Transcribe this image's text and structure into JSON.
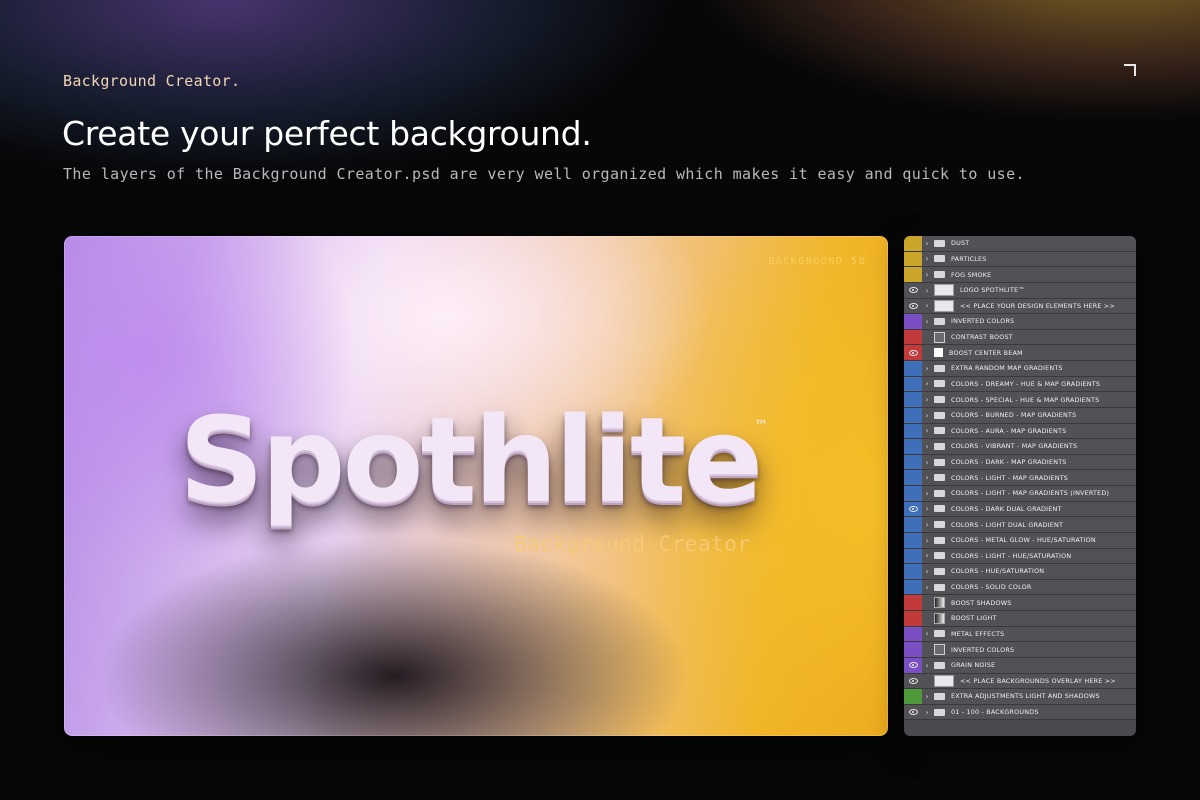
{
  "header": {
    "eyebrow": "Background Creator.",
    "title": "Create your perfect background.",
    "subtitle": "The layers of the Background Creator.psd are very well organized which makes it easy and quick to use."
  },
  "preview": {
    "tag": "BACKGROUND 58",
    "logo_text": "Spothlite",
    "logo_tm": "™",
    "logo_subtitle": "Background Creator"
  },
  "layers": [
    {
      "name": "DUST",
      "color": "#c9a62a",
      "visible": false,
      "type": "folder",
      "expandable": true
    },
    {
      "name": "PARTICLES",
      "color": "#c9a62a",
      "visible": false,
      "type": "folder",
      "expandable": true
    },
    {
      "name": "FOG SMOKE",
      "color": "#c9a62a",
      "visible": false,
      "type": "folder",
      "expandable": true
    },
    {
      "name": "LOGO SPOTHLITE™",
      "color": "",
      "visible": true,
      "type": "box",
      "expandable": true
    },
    {
      "name": "<< PLACE YOUR DESIGN ELEMENTS HERE >>",
      "color": "",
      "visible": true,
      "type": "box",
      "expandable": true
    },
    {
      "name": "INVERTED COLORS",
      "color": "#7b4fc4",
      "visible": false,
      "type": "folder",
      "expandable": true
    },
    {
      "name": "CONTRAST BOOST",
      "color": "#c23a3a",
      "visible": false,
      "type": "adj",
      "expandable": false
    },
    {
      "name": "BOOST CENTER BEAM",
      "color": "#c23a3a",
      "visible": true,
      "type": "white",
      "expandable": false
    },
    {
      "name": "EXTRA RANDOM MAP GRADIENTS",
      "color": "#3f6fb8",
      "visible": false,
      "type": "folder",
      "expandable": true
    },
    {
      "name": "COLORS - DREAMY - HUE & MAP GRADIENTS",
      "color": "#3f6fb8",
      "visible": false,
      "type": "folder",
      "expandable": true
    },
    {
      "name": "COLORS - SPECIAL - HUE & MAP GRADIENTS",
      "color": "#3f6fb8",
      "visible": false,
      "type": "folder",
      "expandable": true
    },
    {
      "name": "COLORS - BURNED - MAP GRADIENTS",
      "color": "#3f6fb8",
      "visible": false,
      "type": "folder",
      "expandable": true
    },
    {
      "name": "COLORS - AURA - MAP GRADIENTS",
      "color": "#3f6fb8",
      "visible": false,
      "type": "folder",
      "expandable": true
    },
    {
      "name": "COLORS - VIBRANT - MAP GRADIENTS",
      "color": "#3f6fb8",
      "visible": false,
      "type": "folder",
      "expandable": true
    },
    {
      "name": "COLORS - DARK - MAP GRADIENTS",
      "color": "#3f6fb8",
      "visible": false,
      "type": "folder",
      "expandable": true
    },
    {
      "name": "COLORS - LIGHT - MAP GRADIENTS",
      "color": "#3f6fb8",
      "visible": false,
      "type": "folder",
      "expandable": true
    },
    {
      "name": "COLORS - LIGHT - MAP GRADIENTS (INVERTED)",
      "color": "#3f6fb8",
      "visible": false,
      "type": "folder",
      "expandable": true
    },
    {
      "name": "COLORS - DARK DUAL GRADIENT",
      "color": "#3f6fb8",
      "visible": true,
      "type": "folder",
      "expandable": true
    },
    {
      "name": "COLORS - LIGHT DUAL GRADIENT",
      "color": "#3f6fb8",
      "visible": false,
      "type": "folder",
      "expandable": true
    },
    {
      "name": "COLORS - METAL GLOW - HUE/SATURATION",
      "color": "#3f6fb8",
      "visible": false,
      "type": "folder",
      "expandable": true
    },
    {
      "name": "COLORS - LIGHT - HUE/SATURATION",
      "color": "#3f6fb8",
      "visible": false,
      "type": "folder",
      "expandable": true
    },
    {
      "name": "COLORS - HUE/SATURATION",
      "color": "#3f6fb8",
      "visible": false,
      "type": "folder",
      "expandable": true
    },
    {
      "name": "COLORS - SOLID COLOR",
      "color": "#3f6fb8",
      "visible": false,
      "type": "folder",
      "expandable": true
    },
    {
      "name": "BOOST SHADOWS",
      "color": "#c23a3a",
      "visible": false,
      "type": "grad",
      "expandable": false
    },
    {
      "name": "BOOST LIGHT",
      "color": "#c23a3a",
      "visible": false,
      "type": "grad",
      "expandable": false
    },
    {
      "name": "METAL EFFECTS",
      "color": "#7b4fc4",
      "visible": false,
      "type": "folder",
      "expandable": true
    },
    {
      "name": "INVERTED COLORS",
      "color": "#7b4fc4",
      "visible": false,
      "type": "adj",
      "expandable": false
    },
    {
      "name": "GRAIN NOISE",
      "color": "#7b4fc4",
      "visible": true,
      "type": "folder",
      "expandable": true
    },
    {
      "name": "<< PLACE BACKGROUNDS OVERLAY HERE >>",
      "color": "",
      "visible": true,
      "type": "box",
      "expandable": false
    },
    {
      "name": "EXTRA ADJUSTMENTS LIGHT AND SHADOWS",
      "color": "#4f9a3a",
      "visible": false,
      "type": "folder",
      "expandable": true
    },
    {
      "name": "01 - 100 - BACKGROUNDS",
      "color": "",
      "visible": true,
      "type": "folder",
      "expandable": true
    }
  ]
}
